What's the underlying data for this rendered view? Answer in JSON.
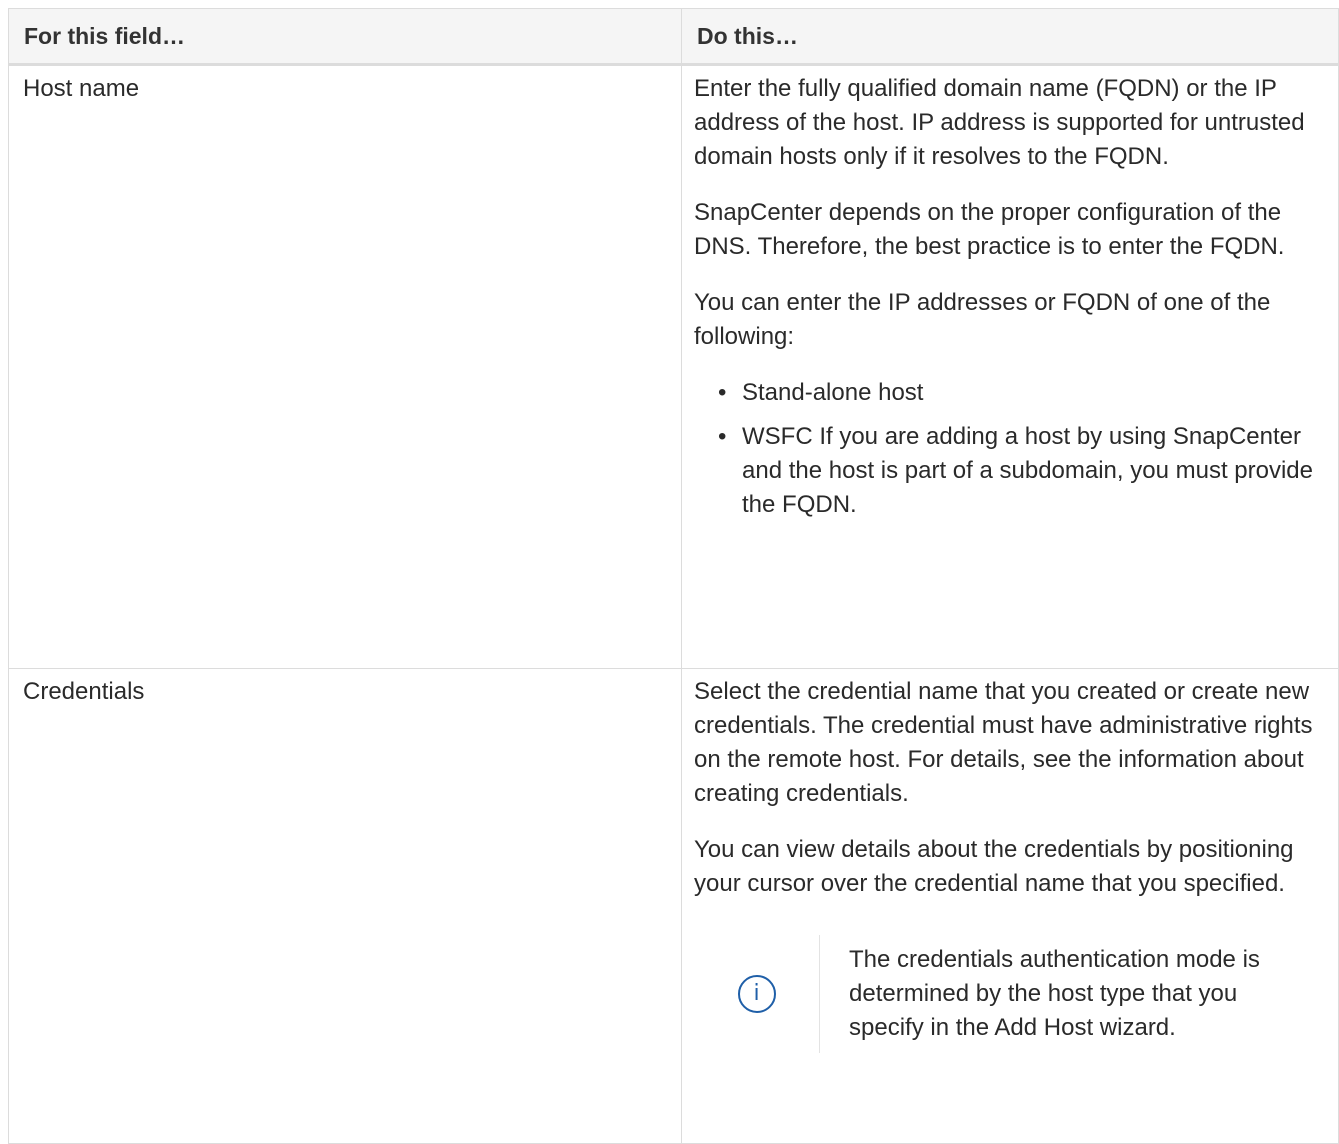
{
  "table": {
    "headers": {
      "field": "For this field…",
      "action": "Do this…"
    },
    "rows": [
      {
        "field": "Host name",
        "paragraphs": [
          "Enter the fully qualified domain name (FQDN) or the IP address of the host. IP address is supported for untrusted domain hosts only if it resolves to the FQDN.",
          "SnapCenter depends on the proper configuration of the DNS. Therefore, the best practice is to enter the FQDN.",
          "You can enter the IP addresses or FQDN of one of the following:"
        ],
        "bullets": [
          "Stand-alone host",
          "WSFC If you are adding a host by using SnapCenter and the host is part of a subdomain, you must provide the FQDN."
        ]
      },
      {
        "field": "Credentials",
        "paragraphs": [
          "Select the credential name that you created or create new credentials. The credential must have administrative rights on the remote host. For details, see the information about creating credentials.",
          "You can view details about the credentials by positioning your cursor over the credential name that you specified."
        ],
        "note": {
          "icon": "info-icon",
          "text": "The credentials authentication mode is determined by the host type that you specify in the Add Host wizard."
        }
      }
    ]
  },
  "colors": {
    "border": "#dcdcdc",
    "header_background": "#f5f5f5",
    "text": "#2a2a2a",
    "info_icon": "#1f5fa8"
  }
}
